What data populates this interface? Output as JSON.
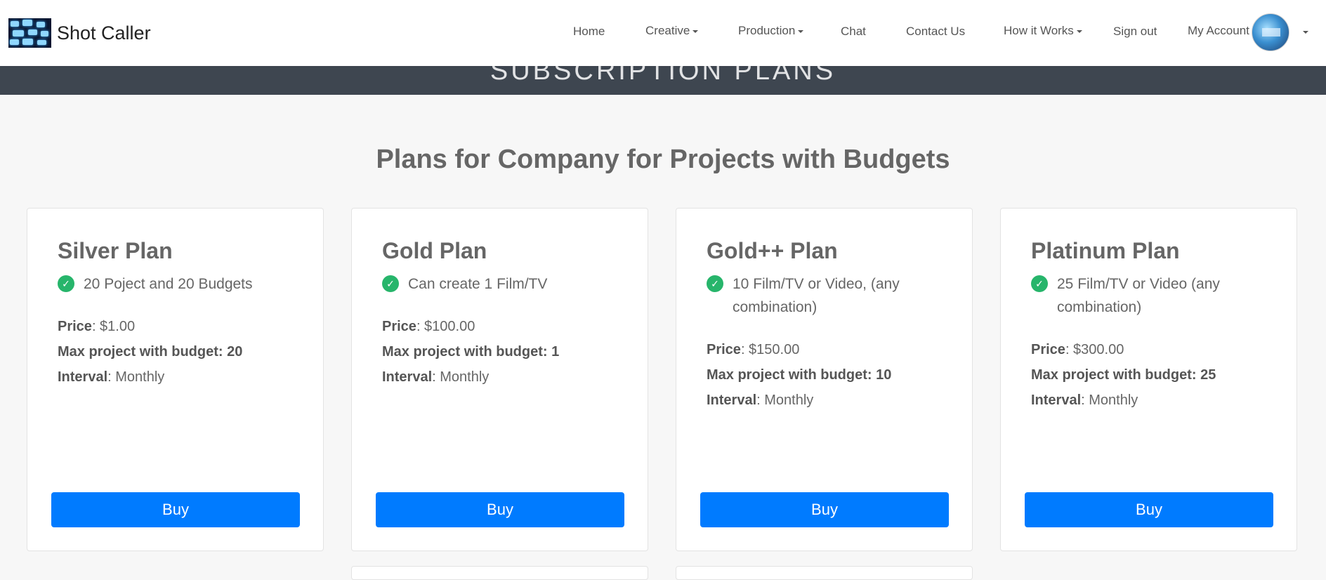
{
  "navbar": {
    "brand": "Shot Caller",
    "items": [
      {
        "label": "Home",
        "dropdown": false
      },
      {
        "label": "Creative",
        "dropdown": true
      },
      {
        "label": "Production",
        "dropdown": true
      },
      {
        "label": "Chat",
        "dropdown": false
      },
      {
        "label": "Contact Us",
        "dropdown": false
      },
      {
        "label": "How it Works",
        "dropdown": true
      },
      {
        "label": "Sign out",
        "dropdown": false
      },
      {
        "label": "My Account",
        "dropdown": false
      }
    ]
  },
  "hero": {
    "title": "SUBSCRIPTION PLANS"
  },
  "section": {
    "title": "Plans for Company for Projects with Budgets"
  },
  "plans": [
    {
      "name": "Silver Plan",
      "feature": "20 Poject and 20 Budgets",
      "price_label": "Price",
      "price": ": $1.00",
      "max_label": "Max project with budget: 20",
      "interval_label": "Interval",
      "interval": ": Monthly",
      "buy_label": "Buy"
    },
    {
      "name": "Gold Plan",
      "feature": "Can create 1 Film/TV",
      "price_label": "Price",
      "price": ": $100.00",
      "max_label": "Max project with budget: 1",
      "interval_label": "Interval",
      "interval": ": Monthly",
      "buy_label": "Buy"
    },
    {
      "name": "Gold++ Plan",
      "feature": "10 Film/TV or Video, (any combination)",
      "price_label": "Price",
      "price": ": $150.00",
      "max_label": "Max project with budget: 10",
      "interval_label": "Interval",
      "interval": ": Monthly",
      "buy_label": "Buy"
    },
    {
      "name": "Platinum Plan",
      "feature": "25 Film/TV or Video (any combination)",
      "price_label": "Price",
      "price": ": $300.00",
      "max_label": "Max project with budget: 25",
      "interval_label": "Interval",
      "interval": ": Monthly",
      "buy_label": "Buy"
    }
  ],
  "icons": {
    "check": "check-circle-icon",
    "caret": "caret-down-icon"
  },
  "colors": {
    "accent": "#007bff",
    "check": "#27b56b",
    "hero": "#3e4650",
    "text": "#666666"
  }
}
